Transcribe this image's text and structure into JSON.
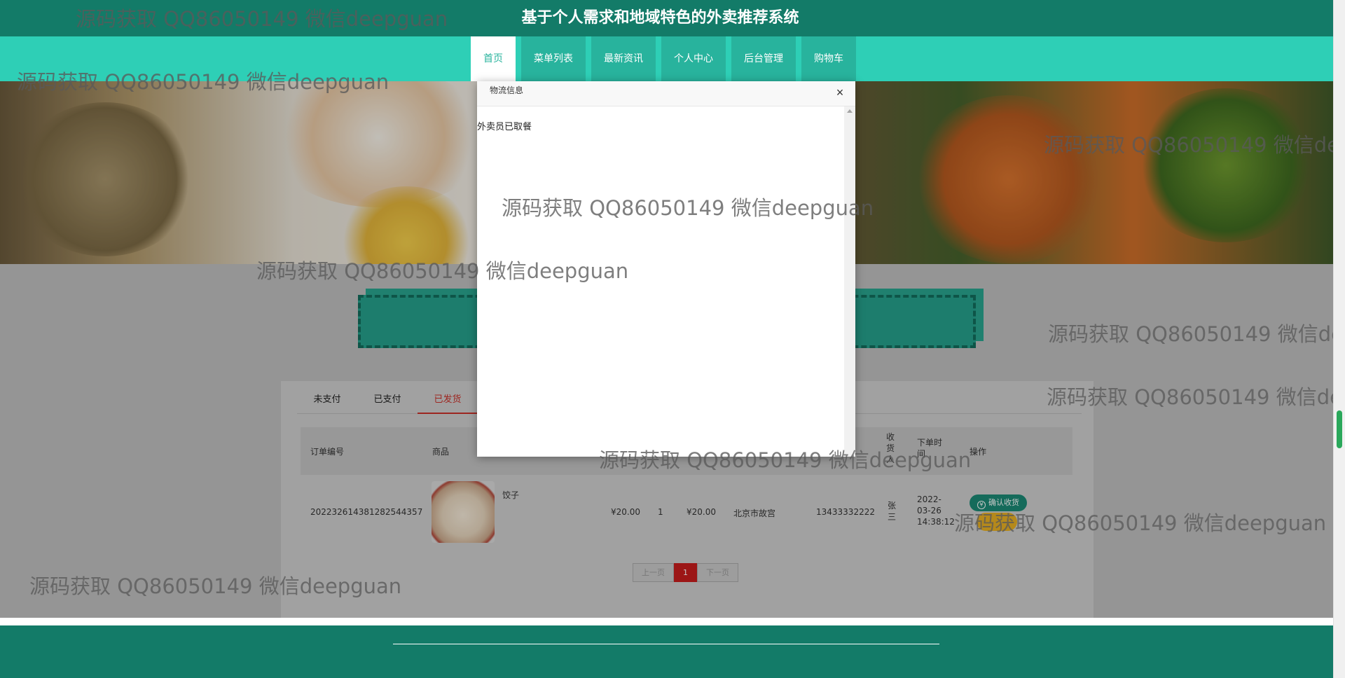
{
  "site": {
    "title": "基于个人需求和地域特色的外卖推荐系统"
  },
  "nav": {
    "items": [
      {
        "label": "首页",
        "active": true
      },
      {
        "label": "菜单列表"
      },
      {
        "label": "最新资讯"
      },
      {
        "label": "个人中心"
      },
      {
        "label": "后台管理"
      },
      {
        "label": "购物车"
      }
    ]
  },
  "orders": {
    "tabs": [
      {
        "label": "未支付"
      },
      {
        "label": "已支付"
      },
      {
        "label": "已发货",
        "active": true
      }
    ],
    "columns": {
      "order_no": "订单编号",
      "product": "商品",
      "recipient": "收货人",
      "order_time": "下单时间",
      "action": "操作"
    },
    "row": {
      "order_no": "20223261438128254​4357",
      "product_name": "饺子",
      "price": "¥20.00",
      "quantity": "1",
      "total": "¥20.00",
      "address": "北京市故宫",
      "phone": "13433332222",
      "recipient": "张三",
      "order_time": "2022-03-26 14:38:12",
      "action_label": "确认收货"
    },
    "pager": {
      "prev": "上一页",
      "current": "1",
      "next": "下一页"
    }
  },
  "modal": {
    "title": "物流信息",
    "close": "×",
    "body_text": "外卖员已取餐"
  },
  "watermark": "源码获取 QQ86050149 微信deepguan",
  "colors": {
    "header": "#137b68",
    "nav": "#2ecfb6",
    "accent": "#26a18c",
    "active_tab": "#c9312a",
    "pager_active": "#c81d1d"
  }
}
